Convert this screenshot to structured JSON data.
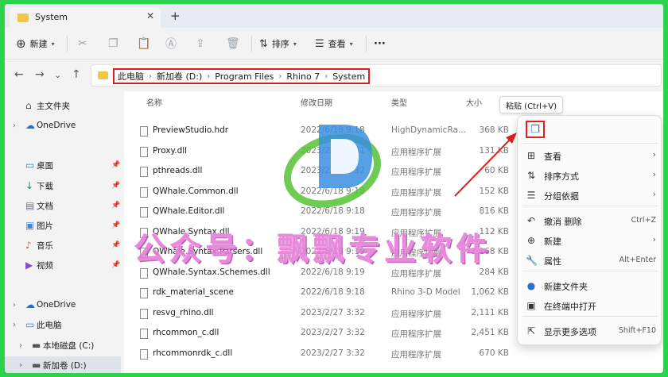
{
  "tab": {
    "title": "System"
  },
  "toolbar": {
    "new_label": "新建",
    "sort_label": "排序",
    "view_label": "查看",
    "more_label": "···"
  },
  "breadcrumb": [
    "此电脑",
    "新加卷 (D:)",
    "Program Files",
    "Rhino 7",
    "System"
  ],
  "sidebar": {
    "items": [
      {
        "label": "主文件夹",
        "chevron": false,
        "pinned": false,
        "icon": "home-icon",
        "color": "#555555"
      },
      {
        "label": "OneDrive",
        "chevron": true,
        "pinned": false,
        "icon": "cloud-icon",
        "color": "#1f6fd0"
      },
      {
        "label": "桌面",
        "chevron": false,
        "pinned": true,
        "icon": "desktop-icon",
        "color": "#2b7fd6"
      },
      {
        "label": "下载",
        "chevron": false,
        "pinned": true,
        "icon": "download-icon",
        "color": "#1e8a5a"
      },
      {
        "label": "文档",
        "chevron": false,
        "pinned": true,
        "icon": "document-icon",
        "color": "#6b7785"
      },
      {
        "label": "图片",
        "chevron": false,
        "pinned": true,
        "icon": "picture-icon",
        "color": "#3a86d9"
      },
      {
        "label": "音乐",
        "chevron": false,
        "pinned": true,
        "icon": "music-icon",
        "color": "#e0582a"
      },
      {
        "label": "视频",
        "chevron": false,
        "pinned": true,
        "icon": "video-icon",
        "color": "#7b4fc9"
      },
      {
        "label": "OneDrive",
        "chevron": true,
        "pinned": false,
        "icon": "cloud-icon",
        "color": "#1f6fd0"
      },
      {
        "label": "此电脑",
        "chevron": true,
        "pinned": false,
        "icon": "computer-icon",
        "color": "#2b7fd6"
      },
      {
        "label": "本地磁盘 (C:)",
        "chevron": true,
        "pinned": false,
        "icon": "drive-icon",
        "color": "#555555"
      },
      {
        "label": "新加卷 (D:)",
        "chevron": true,
        "pinned": false,
        "icon": "drive-icon",
        "color": "#555555"
      }
    ]
  },
  "columns": {
    "name": "名称",
    "date": "修改日期",
    "type": "类型",
    "size": "大小"
  },
  "files": [
    {
      "name": "PreviewStudio.hdr",
      "date": "2022/6/18 9:18",
      "type": "HighDynamicRa...",
      "size": "368 KB"
    },
    {
      "name": "Proxy.dll",
      "date": "2023/2/27 3:31",
      "type": "应用程序扩展",
      "size": "131 KB"
    },
    {
      "name": "pthreads.dll",
      "date": "2023/2/27 3:32",
      "type": "应用程序扩展",
      "size": "60 KB"
    },
    {
      "name": "QWhale.Common.dll",
      "date": "2022/6/18 9:19",
      "type": "应用程序扩展",
      "size": "152 KB"
    },
    {
      "name": "QWhale.Editor.dll",
      "date": "2022/6/18 9:18",
      "type": "应用程序扩展",
      "size": "816 KB"
    },
    {
      "name": "QWhale.Syntax.dll",
      "date": "2022/6/18 9:19",
      "type": "应用程序扩展",
      "size": "112 KB"
    },
    {
      "name": "QWhale.Syntax.Parsers.dll",
      "date": "2022/6/18 9:19",
      "type": "应用程序扩展",
      "size": "1,168 KB"
    },
    {
      "name": "QWhale.Syntax.Schemes.dll",
      "date": "2022/6/18 9:19",
      "type": "应用程序扩展",
      "size": "284 KB"
    },
    {
      "name": "rdk_material_scene",
      "date": "2022/6/18 9:18",
      "type": "Rhino 3-D Model",
      "size": "1,062 KB"
    },
    {
      "name": "resvg_rhino.dll",
      "date": "2023/2/27 3:32",
      "type": "应用程序扩展",
      "size": "2,111 KB"
    },
    {
      "name": "rhcommon_c.dll",
      "date": "2023/2/27 3:32",
      "type": "应用程序扩展",
      "size": "2,451 KB"
    },
    {
      "name": "rhcommonrdk_c.dll",
      "date": "2023/2/27 3:32",
      "type": "应用程序扩展",
      "size": "670 KB"
    }
  ],
  "tooltip": "粘贴 (Ctrl+V)",
  "menu": {
    "items": [
      {
        "label": "查看",
        "shortcut": "",
        "arrow": true,
        "icon": "view-icon"
      },
      {
        "label": "排序方式",
        "shortcut": "",
        "arrow": true,
        "icon": "sort-icon"
      },
      {
        "label": "分组依据",
        "shortcut": "",
        "arrow": true,
        "icon": "group-icon"
      },
      {
        "label": "撤消 删除",
        "shortcut": "Ctrl+Z",
        "arrow": false,
        "icon": "undo-icon"
      },
      {
        "label": "新建",
        "shortcut": "",
        "arrow": true,
        "icon": "new-icon"
      },
      {
        "label": "属性",
        "shortcut": "Alt+Enter",
        "arrow": false,
        "icon": "properties-icon"
      },
      {
        "label": "新建文件夹",
        "shortcut": "",
        "arrow": false,
        "icon": "new-folder-icon"
      },
      {
        "label": "在终端中打开",
        "shortcut": "",
        "arrow": false,
        "icon": "terminal-icon"
      },
      {
        "label": "显示更多选项",
        "shortcut": "Shift+F10",
        "arrow": false,
        "icon": "more-options-icon"
      }
    ]
  },
  "watermark": "公众号：飘飘专业软件",
  "colors": {
    "accent": "#2a6fd6",
    "highlight": "#e02020",
    "frame": "#2bd24a",
    "watermark": "#e879d8"
  }
}
